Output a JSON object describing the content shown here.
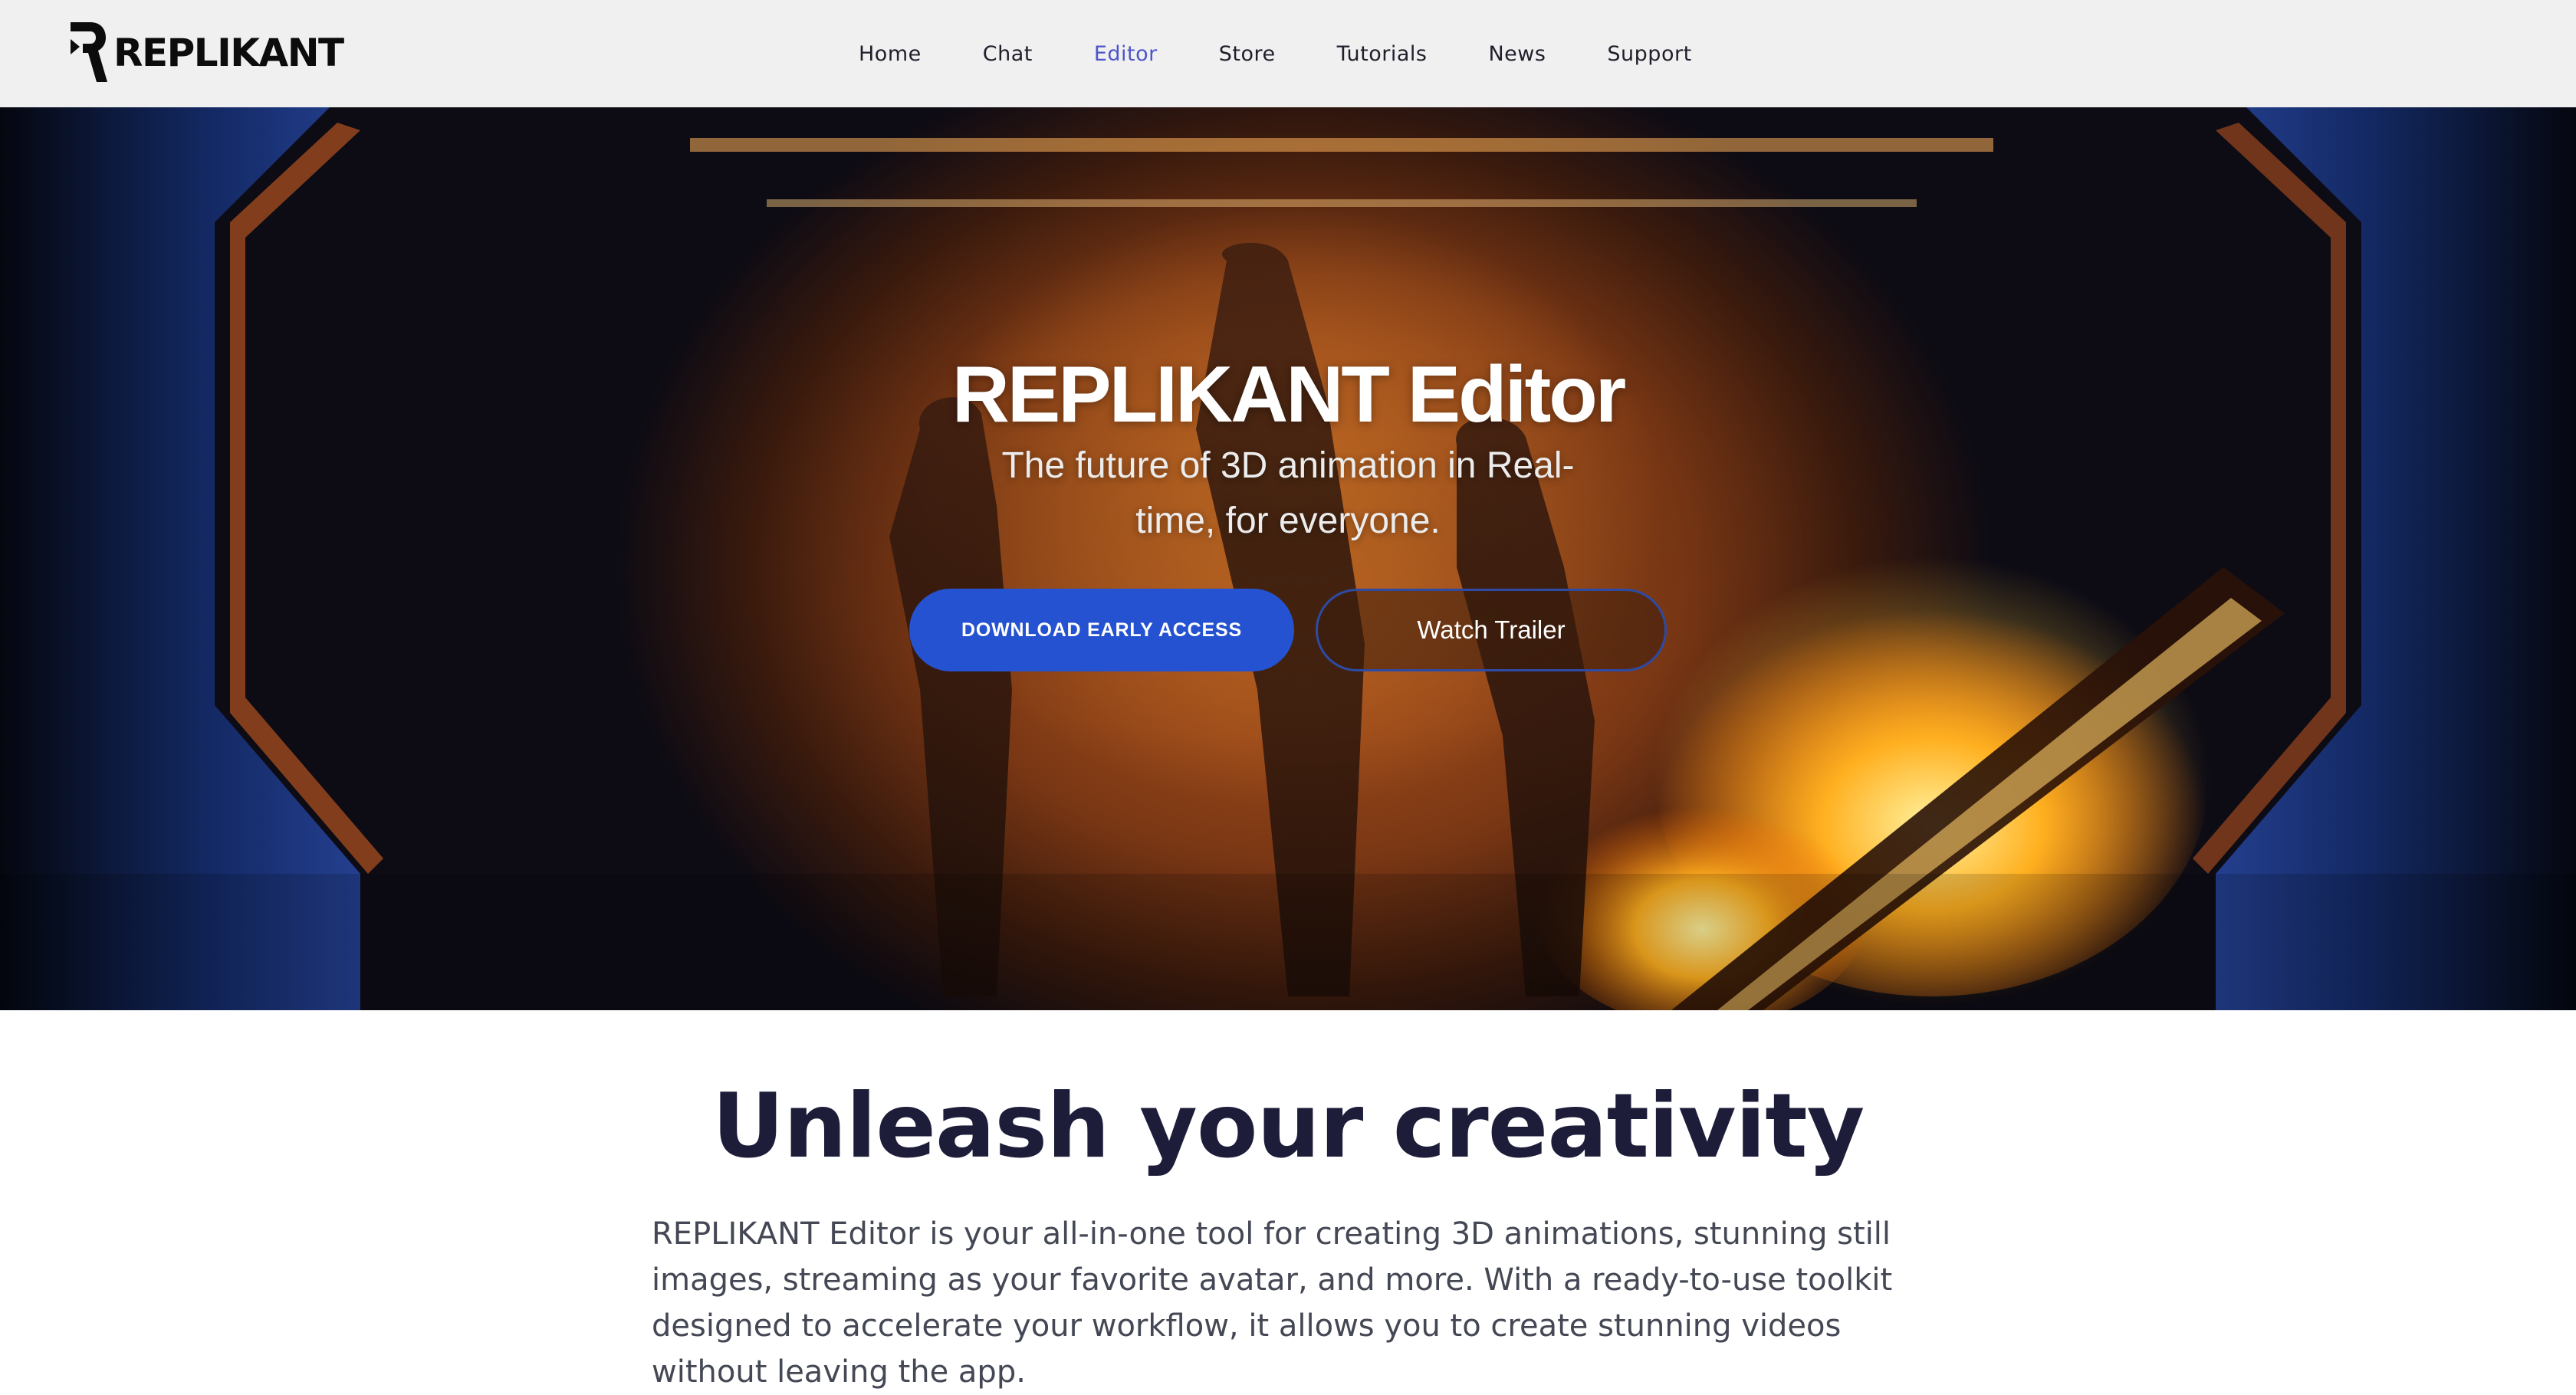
{
  "brand": {
    "name": "REPLIKANT",
    "logo_icon": "replikant-r-logo-icon"
  },
  "nav": {
    "items": [
      {
        "label": "Home",
        "active": false
      },
      {
        "label": "Chat",
        "active": false
      },
      {
        "label": "Editor",
        "active": true
      },
      {
        "label": "Store",
        "active": false
      },
      {
        "label": "Tutorials",
        "active": false
      },
      {
        "label": "News",
        "active": false
      },
      {
        "label": "Support",
        "active": false
      }
    ],
    "active_color": "#4f55c9"
  },
  "hero": {
    "title": "REPLIKANT Editor",
    "subtitle": "The future of 3D animation in Real-time, for everyone.",
    "primary_cta": "DOWNLOAD EARLY ACCESS",
    "secondary_cta": "Watch Trailer",
    "primary_color": "#2552d0"
  },
  "section": {
    "title": "Unleash your creativity",
    "body": "REPLIKANT Editor is your all-in-one tool for creating 3D animations, stunning still images, streaming as your favorite avatar, and more. With a ready-to-use toolkit designed to accelerate your workflow, it allows you to create stunning videos without leaving the app."
  }
}
